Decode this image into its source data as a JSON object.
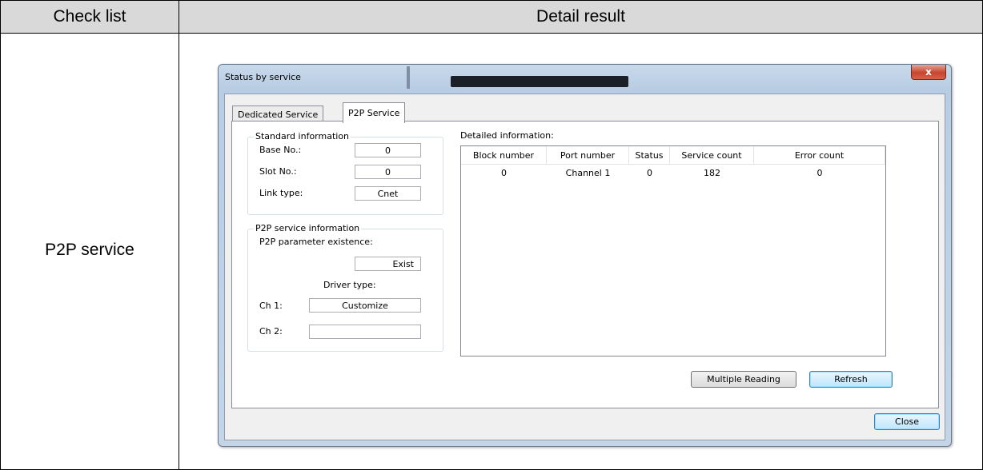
{
  "table": {
    "header_check": "Check list",
    "header_detail": "Detail result",
    "row_label": "P2P service"
  },
  "dialog": {
    "title": "Status by service",
    "close_glyph": "x",
    "tabs": [
      {
        "label": "Dedicated Service",
        "active": false
      },
      {
        "label": "P2P Service",
        "active": true
      }
    ],
    "standard_info": {
      "legend": "Standard information",
      "base_label": "Base No.:",
      "base_value": "0",
      "slot_label": "Slot No.:",
      "slot_value": "0",
      "link_label": "Link type:",
      "link_value": "Cnet"
    },
    "p2p_info": {
      "legend": "P2P service information",
      "param_label": "P2P parameter existence:",
      "param_value": "Exist",
      "driver_label": "Driver type:",
      "ch1_label": "Ch 1:",
      "ch1_value": "Customize",
      "ch2_label": "Ch 2:",
      "ch2_value": ""
    },
    "detailed": {
      "label": "Detailed information:",
      "columns": [
        "Block number",
        "Port number",
        "Status",
        "Service count",
        "Error count"
      ],
      "rows": [
        [
          "0",
          "Channel 1",
          "0",
          "182",
          "0"
        ]
      ]
    },
    "buttons": {
      "multiple_reading": "Multiple Reading",
      "refresh": "Refresh",
      "close": "Close"
    }
  }
}
